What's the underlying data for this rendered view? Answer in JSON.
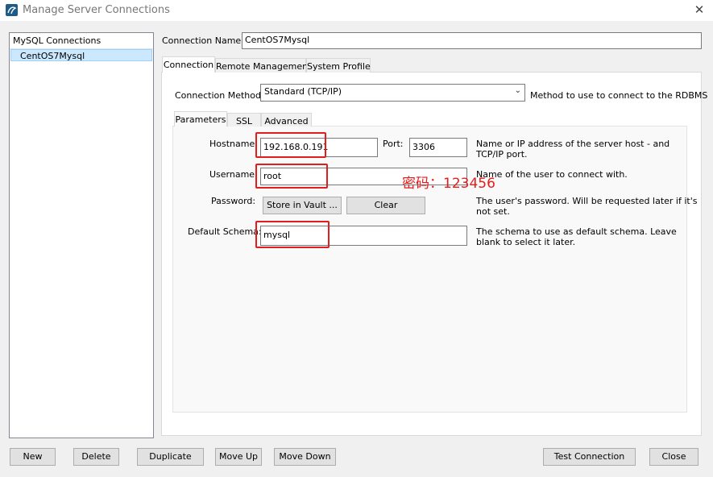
{
  "window": {
    "title": "Manage Server Connections"
  },
  "left_panel": {
    "header": "MySQL Connections",
    "items": [
      {
        "label": "CentOS7Mysql",
        "selected": true
      }
    ]
  },
  "connection": {
    "name_label": "Connection Name:",
    "name_value": "CentOS7Mysql"
  },
  "tabs": [
    "Connection",
    "Remote Management",
    "System Profile"
  ],
  "connection_method": {
    "label": "Connection Method:",
    "value": "Standard (TCP/IP)",
    "description": "Method to use to connect to the RDBMS"
  },
  "subtabs": [
    "Parameters",
    "SSL",
    "Advanced"
  ],
  "params": {
    "hostname_label": "Hostname:",
    "hostname_value": "192.168.0.191",
    "port_label": "Port:",
    "port_value": "3306",
    "hostname_desc": [
      "Name or IP address of the server host - and",
      "TCP/IP port."
    ],
    "username_label": "Username:",
    "username_value": "root",
    "username_desc": "Name of the user to connect with.",
    "password_label": "Password:",
    "store_vault_btn": "Store in Vault ...",
    "clear_btn": "Clear",
    "password_desc": [
      "The user's password. Will be requested later if it's",
      "not set."
    ],
    "schema_label": "Default Schema:",
    "schema_value": "mysql",
    "schema_desc": [
      "The schema to use as default schema. Leave",
      "blank to select it later."
    ]
  },
  "annotation": "密码：123456",
  "bottom_buttons": {
    "new": "New",
    "delete": "Delete",
    "duplicate": "Duplicate",
    "move_up": "Move Up",
    "move_down": "Move Down",
    "test_connection": "Test Connection",
    "close": "Close"
  },
  "colors": {
    "highlight_red": "#e01e1e",
    "selection_blue": "#cce8ff"
  }
}
